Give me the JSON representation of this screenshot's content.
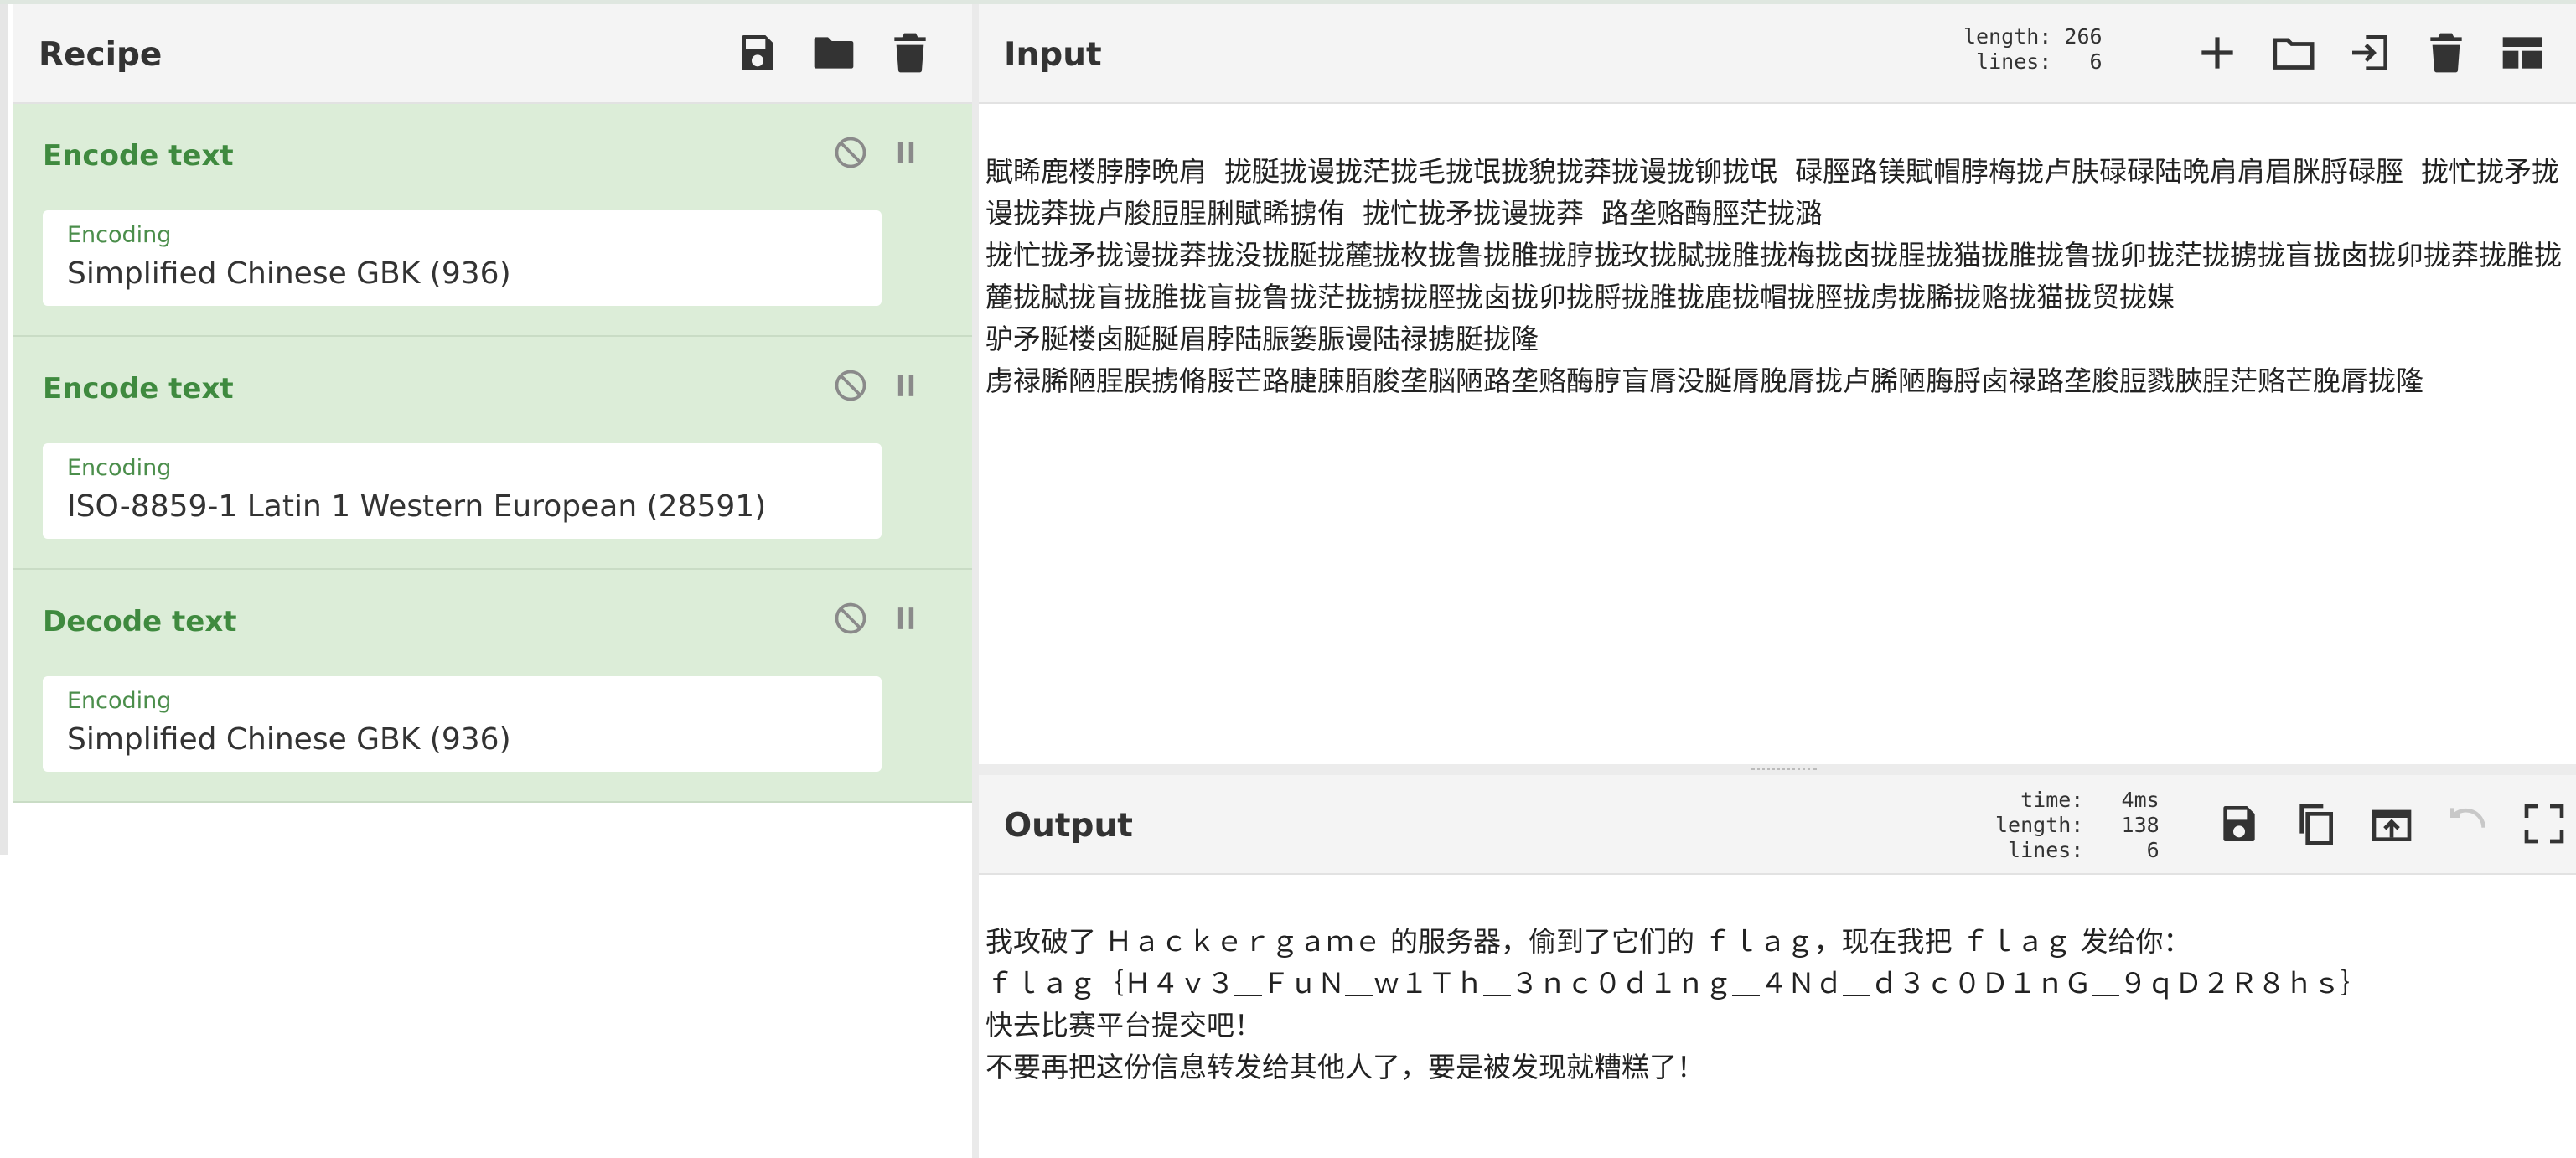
{
  "recipe": {
    "title": "Recipe",
    "operations": [
      {
        "name": "Encode text",
        "field_label": "Encoding",
        "field_value": "Simplified Chinese GBK (936)"
      },
      {
        "name": "Encode text",
        "field_label": "Encoding",
        "field_value": "ISO-8859-1 Latin 1 Western European (28591)"
      },
      {
        "name": "Decode text",
        "field_label": "Encoding",
        "field_value": "Simplified Chinese GBK (936)"
      }
    ]
  },
  "input": {
    "title": "Input",
    "stats": "length: 266\n lines:   6",
    "text": "賦睎鹿楼脖脖晩肩  拢脡拢谩拢茫拢毛拢氓拢貌拢莽拢谩拢铆拢氓  碌脛路镁賦帽脖梅拢卢肤碌碌陆晩肩肩眉脒脟碌脛  拢忙拢矛拢谩拢莽拢卢脧脰脭脷賦睎掳侑  拢忙拢矛拢谩拢莽  路垄赂酶脛茫拢潞\n拢忙拢矛拢谩拢莽拢没拢脠拢麓拢枚拢鲁拢脽拢脝拢玫拢脦拢脽拢梅拢卤拢脭拢猫拢脽拢鲁拢卯拢茫拢掳拢盲拢卤拢卯拢莽拢脽拢麓拢脦拢盲拢脽拢盲拢鲁拢茫拢掳拢脛拢卤拢卯拢脟拢脽拢鹿拢帽拢脛拢虏拢脪拢赂拢猫拢贸拢媒\n驴矛脠楼卤脠脠眉脖陆脤篓脤谩陆禄掳脡拢隆\n虏禄脪陋脭脵掳脩脮芒路脻脨脜脧垄脳陋路垄赂酶脝盲脣没脠脣脕脣拢卢脪陋脢脟卤禄路垄脧脰戮脥脭茫赂芒脕脣拢隆"
  },
  "output": {
    "title": "Output",
    "stats": "  time:   4ms\nlength:   138\n lines:     6",
    "text": "我攻破了 Ｈａｃｋｅｒｇａｍｅ 的服务器，偷到了它们的 ｆｌａｇ，现在我把 ｆｌａｇ 发给你：\nｆｌａｇ｛Ｈ４ｖ３＿ＦｕＮ＿ｗ１Ｔｈ＿３ｎｃ０ｄ１ｎｇ＿４Ｎｄ＿ｄ３ｃ０Ｄ１ｎＧ＿９ｑＤ２Ｒ８ｈｓ｝\n快去比赛平台提交吧！\n不要再把这份信息转发给其他人了，要是被发现就糟糕了！"
  },
  "colors": {
    "operation_bg": "#dcedd8",
    "operation_text": "#3f8a3f"
  },
  "icons": [
    "save-icon",
    "folder-icon",
    "trash-icon",
    "plus-icon",
    "import-icon",
    "layout-icon",
    "copy-icon",
    "export-icon",
    "undo-icon",
    "maximize-icon",
    "disable-icon",
    "pause-icon"
  ]
}
